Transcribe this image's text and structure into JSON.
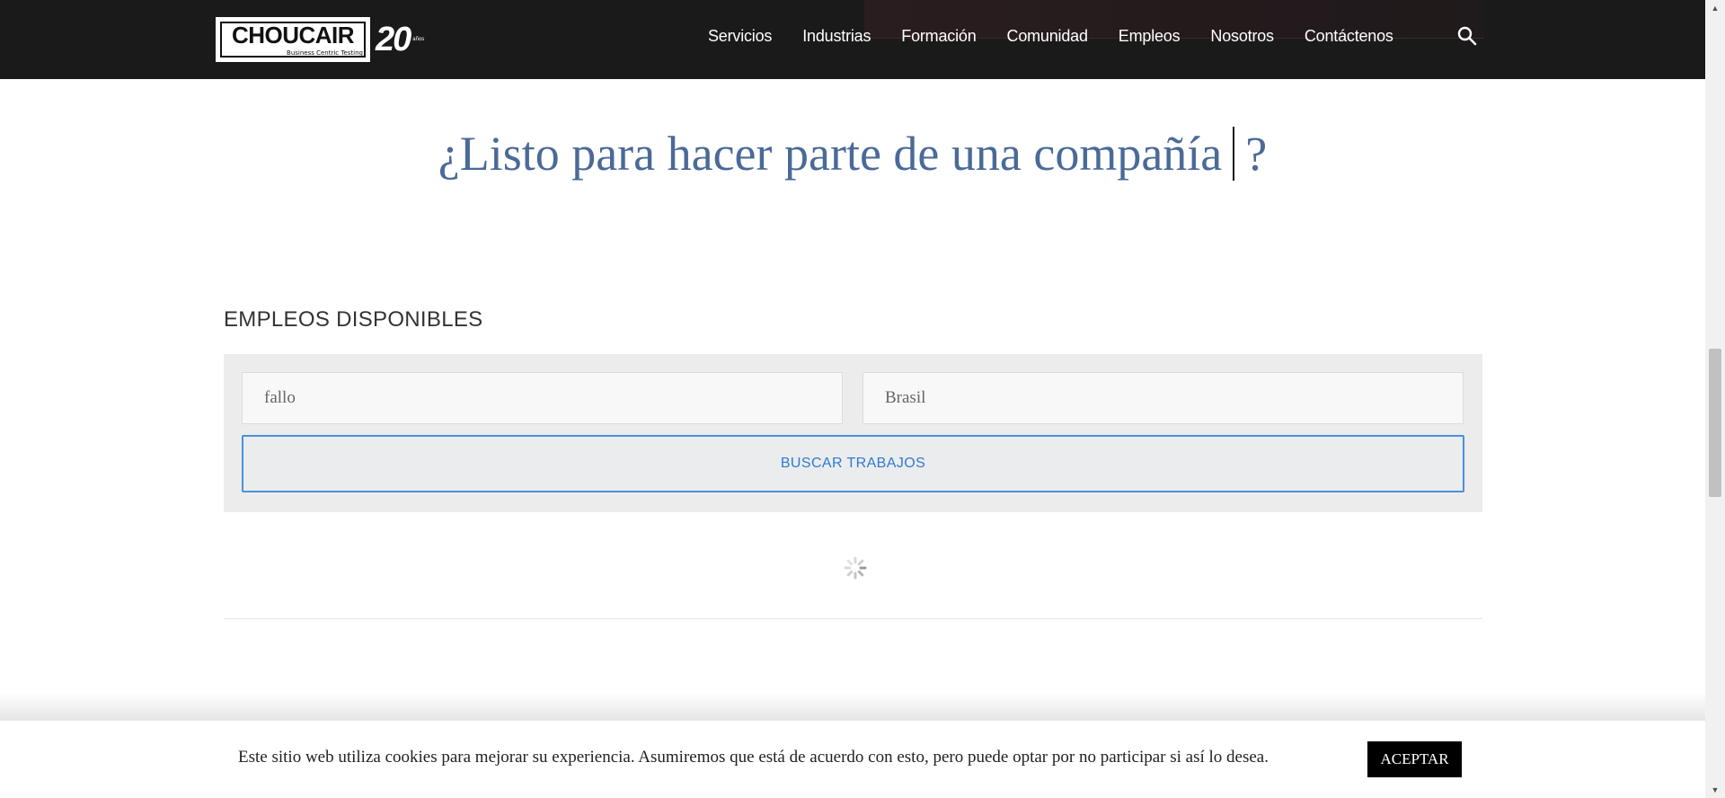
{
  "header": {
    "logo": {
      "brand": "CHOUCAIR",
      "registered": "®",
      "tagline": "Business Centric Testing",
      "anniversary": "20",
      "anniversary_note": "años"
    },
    "nav": [
      "Servicios",
      "Industrias",
      "Formación",
      "Comunidad",
      "Empleos",
      "Nosotros",
      "Contáctenos"
    ]
  },
  "hero": {
    "text": "¿Listo para hacer parte de una compañía",
    "end": "?"
  },
  "jobs": {
    "title": "EMPLEOS DISPONIBLES",
    "keyword_value": "fallo",
    "location_value": "Brasil",
    "search_label": "BUSCAR TRABAJOS"
  },
  "cookie": {
    "text": "Este sitio web utiliza cookies para mejorar su experiencia. Asumiremos que está de acuerdo con esto, pero puede optar por no participar si así lo desea.",
    "accept_label": "ACEPTAR"
  },
  "colors": {
    "header_bg": "#1a1a1a",
    "hero_text": "#4a6a98",
    "accent_blue": "#2e7bd0"
  },
  "icons": {
    "search": "search-icon",
    "loader": "spinner-icon"
  }
}
